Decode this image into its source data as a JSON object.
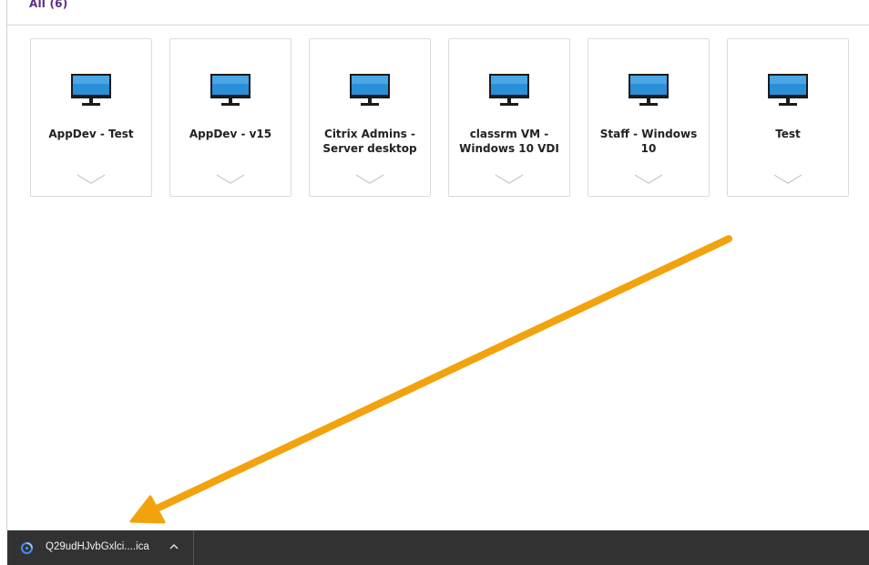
{
  "tab": {
    "label": "All (6)"
  },
  "desktops": [
    {
      "name": "AppDev - Test"
    },
    {
      "name": "AppDev - v15"
    },
    {
      "name": "Citrix Admins -\nServer desktop"
    },
    {
      "name": "classrm VM -\nWindows 10 VDI"
    },
    {
      "name": "Staff - Windows 10"
    },
    {
      "name": "Test"
    }
  ],
  "download_bar": {
    "file_name": "Q29udHJvbGxlci....ica"
  },
  "icons": {
    "desktop": "monitor-icon",
    "details": "chevron-down-icon",
    "download_status": "progress-spinner-icon",
    "download_menu": "chevron-up-icon"
  },
  "colors": {
    "tab_label": "#5b2c86",
    "monitor_screen": "#2a8fd6",
    "monitor_frame": "#1b1b1b",
    "annotation_arrow": "#f2a20c",
    "download_bar_bg": "#323232",
    "download_icon": "#4a8af4"
  }
}
